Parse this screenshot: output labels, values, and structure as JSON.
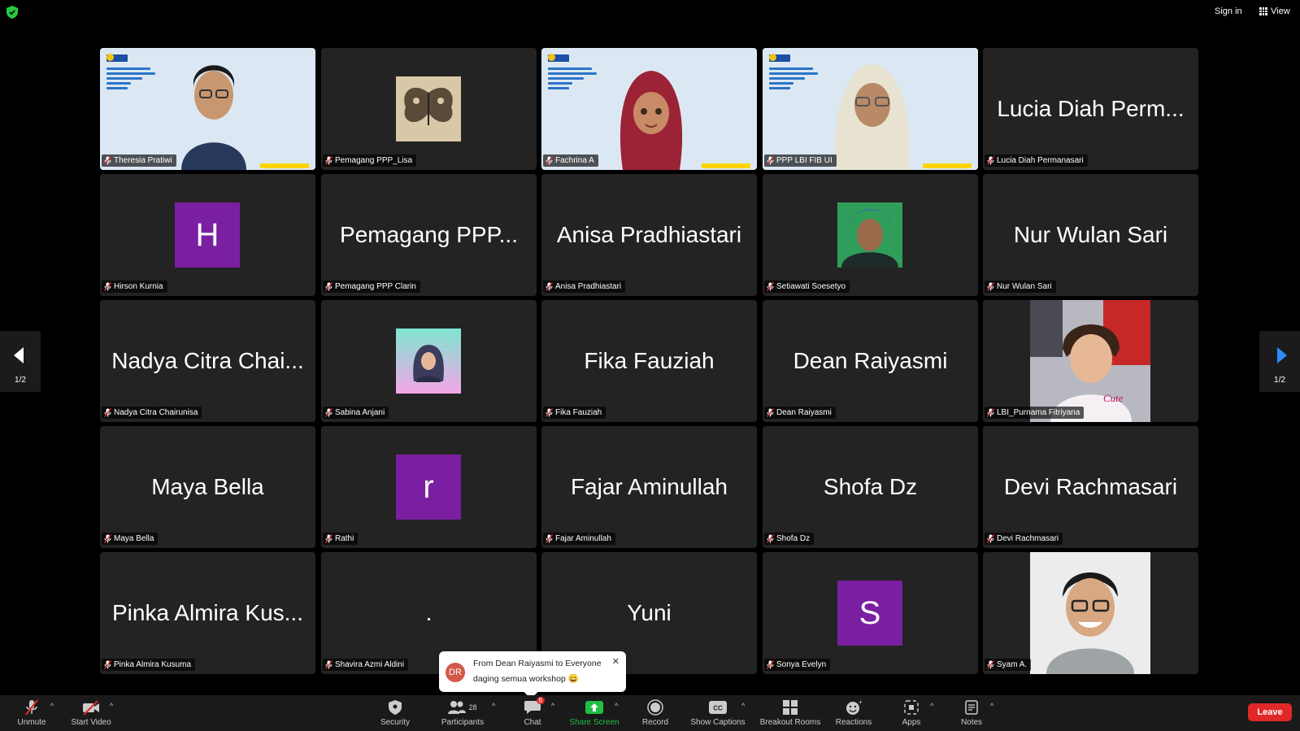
{
  "topbar": {
    "sign_in": "Sign in",
    "view": "View"
  },
  "page_indicator": "1/2",
  "tiles": [
    {
      "name": "Theresia Pratiwi",
      "kind": "slide-person"
    },
    {
      "name": "Pemagang PPP_Lisa",
      "kind": "image-butterfly"
    },
    {
      "name": "Fachrina A",
      "kind": "slide-avatar"
    },
    {
      "name": "PPP LBI FIB UI",
      "kind": "slide-person2",
      "active": true
    },
    {
      "name": "Lucia Diah Permanasari",
      "display": "Lucia Diah Perm..."
    },
    {
      "name": "Hirson Kurnia",
      "letter": "H"
    },
    {
      "name": "Pemagang PPP Clarin",
      "display": "Pemagang PPP..."
    },
    {
      "name": "Anisa Pradhiastari",
      "display": "Anisa Pradhiastari"
    },
    {
      "name": "Setiawati Soesetyo",
      "kind": "image-portrait"
    },
    {
      "name": "Nur Wulan Sari",
      "display": "Nur Wulan Sari"
    },
    {
      "name": "Nadya Citra Chairunisa",
      "display": "Nadya Citra Chai..."
    },
    {
      "name": "Sabina Anjani",
      "kind": "image-hijab"
    },
    {
      "name": "Fika Fauziah",
      "display": "Fika Fauziah"
    },
    {
      "name": "Dean Raiyasmi",
      "display": "Dean Raiyasmi"
    },
    {
      "name": "LBI_Purnama Fitriyana",
      "kind": "image-child"
    },
    {
      "name": "Maya Bella",
      "display": "Maya Bella"
    },
    {
      "name": "Rathi",
      "letter": "r"
    },
    {
      "name": "Fajar Aminullah",
      "display": "Fajar Aminullah"
    },
    {
      "name": "Shofa Dz",
      "display": "Shofa Dz"
    },
    {
      "name": "Devi Rachmasari",
      "display": "Devi Rachmasari"
    },
    {
      "name": "Pinka Almira Kusuma",
      "display": "Pinka Almira Kus..."
    },
    {
      "name": "Shavira Azmi Aldini",
      "display": "."
    },
    {
      "name": "Yuni",
      "display": "Yuni",
      "no_plate": true
    },
    {
      "name": "Sonya Evelyn",
      "letter": "S"
    },
    {
      "name": "Syam A.",
      "kind": "image-man"
    }
  ],
  "chat_toast": {
    "initials": "DR",
    "header": "From Dean Raiyasmi to Everyone",
    "message": "daging semua workshop 😄"
  },
  "toolbar": {
    "unmute": "Unmute",
    "start_video": "Start Video",
    "security": "Security",
    "participants": "Participants",
    "participants_count": "28",
    "chat": "Chat",
    "chat_badge": "8",
    "share_screen": "Share Screen",
    "record": "Record",
    "show_captions": "Show Captions",
    "breakout_rooms": "Breakout Rooms",
    "reactions": "Reactions",
    "apps": "Apps",
    "notes": "Notes",
    "leave": "Leave"
  },
  "colors": {
    "accent_green": "#27c93f",
    "share_green": "#1fbf43",
    "leave_red": "#e02828",
    "avatar_purple": "#7a1fa2"
  }
}
